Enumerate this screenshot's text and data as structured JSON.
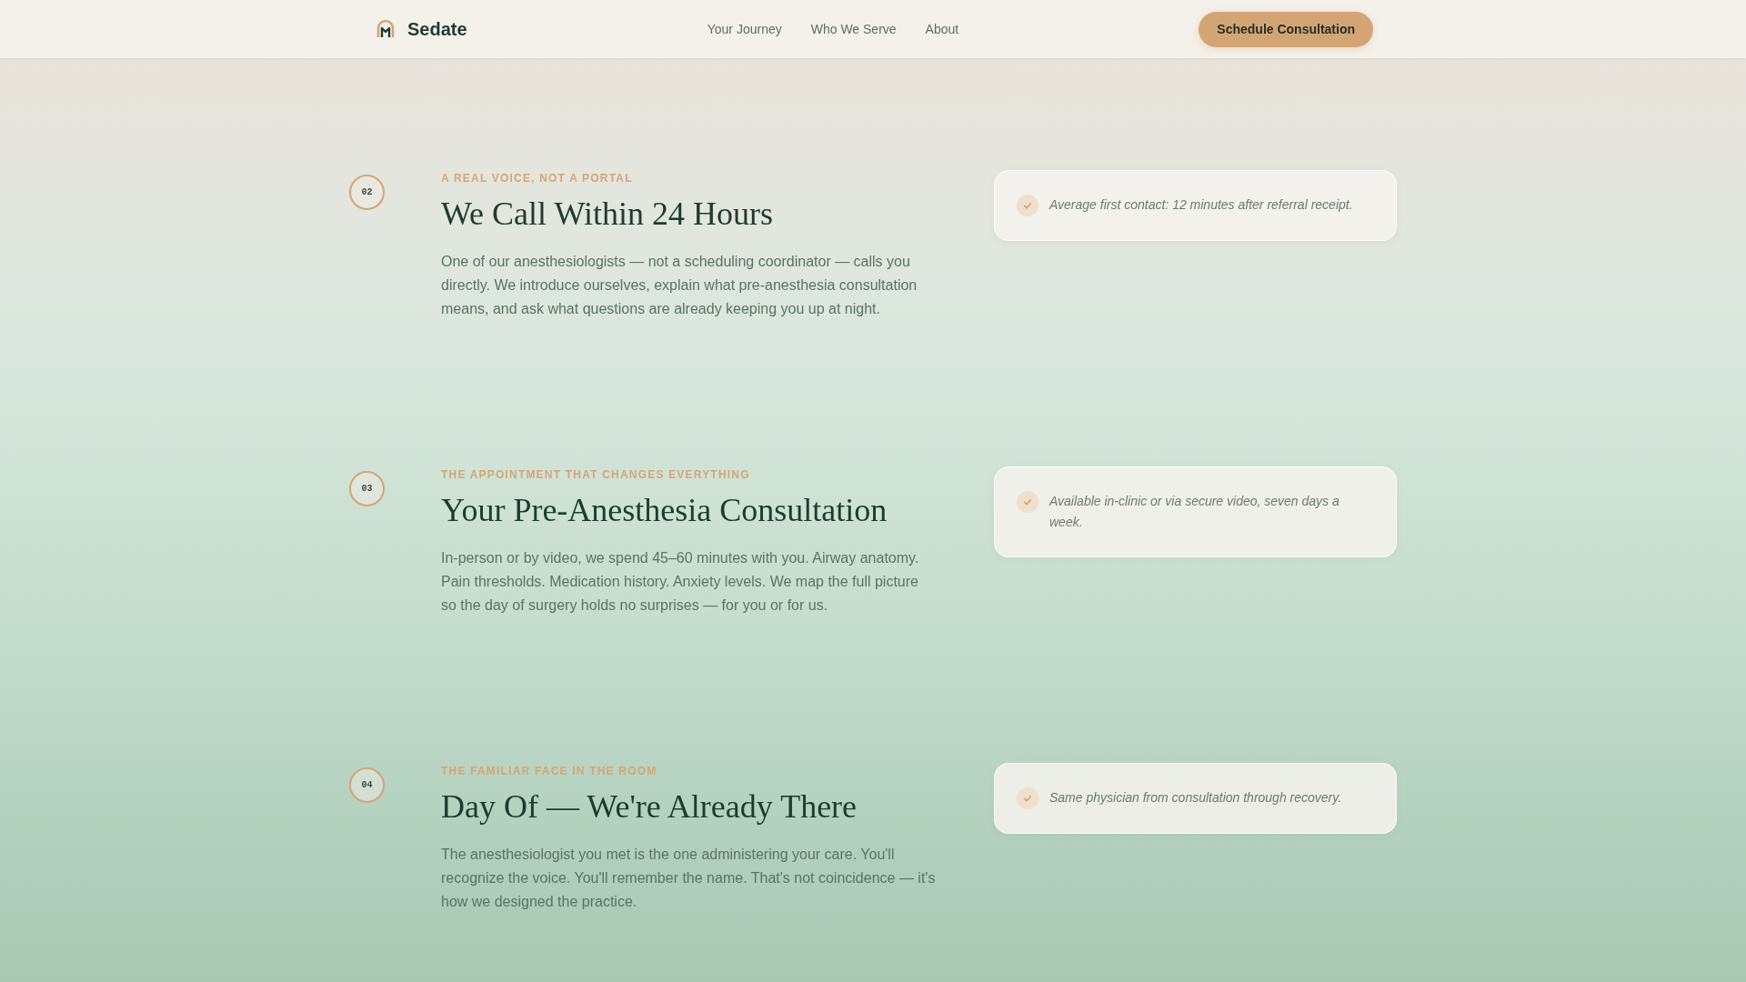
{
  "header": {
    "brand": "Sedate",
    "nav": [
      "Your Journey",
      "Who We Serve",
      "About"
    ],
    "cta": "Schedule Consultation"
  },
  "steps": [
    {
      "number": "02",
      "eyebrow": "A REAL VOICE, NOT A PORTAL",
      "title": "We Call Within 24 Hours",
      "body": "One of our anesthesiologists — not a scheduling coordinator — calls you directly. We introduce ourselves, explain what pre-anesthesia consultation means, and ask what questions are already keeping you up at night.",
      "note": "Average first contact: 12 minutes after referral receipt."
    },
    {
      "number": "03",
      "eyebrow": "THE APPOINTMENT THAT CHANGES EVERYTHING",
      "title": "Your Pre-Anesthesia Consultation",
      "body": "In-person or by video, we spend 45–60 minutes with you. Airway anatomy. Pain thresholds. Medication history. Anxiety levels. We map the full picture so the day of surgery holds no surprises — for you or for us.",
      "note": "Available in-clinic or via secure video, seven days a week."
    },
    {
      "number": "04",
      "eyebrow": "THE FAMILIAR FACE IN THE ROOM",
      "title": "Day Of — We're Already There",
      "body": "The anesthesiologist you met is the one administering your care. You'll recognize the voice. You'll remember the name. That's not coincidence — it's how we designed the practice.",
      "note": "Same physician from consultation through recovery."
    }
  ]
}
